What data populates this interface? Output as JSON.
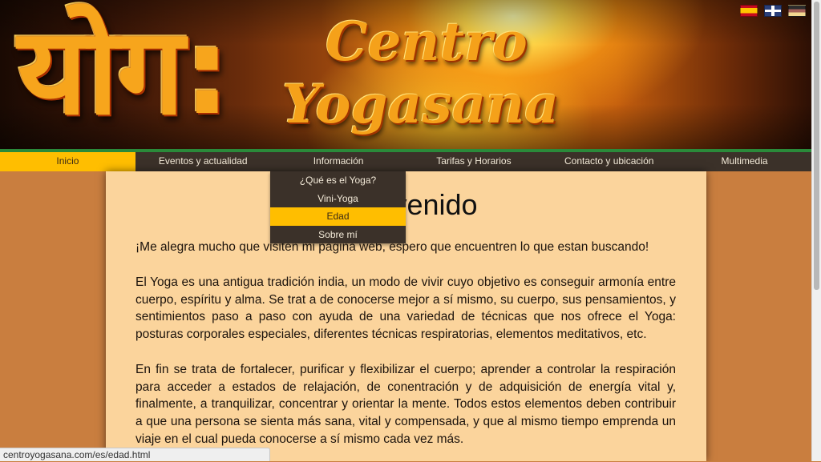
{
  "banner": {
    "logo_devanagari": "योग:",
    "logo_line1": "Centro",
    "logo_line2": "Yogasana",
    "flags": [
      {
        "name": "spanish-flag-icon",
        "lang": "es"
      },
      {
        "name": "english-flag-icon",
        "lang": "en"
      },
      {
        "name": "german-flag-icon",
        "lang": "de"
      }
    ]
  },
  "nav": {
    "items": [
      {
        "label": "Inicio",
        "active": true
      },
      {
        "label": "Eventos y actualidad",
        "active": false
      },
      {
        "label": "Información",
        "active": false
      },
      {
        "label": "Tarifas y Horarios",
        "active": false
      },
      {
        "label": "Contacto y ubicación",
        "active": false
      },
      {
        "label": "Multimedia",
        "active": false
      }
    ],
    "active_color": "#ffbe00",
    "bar_color": "#3b3129"
  },
  "dropdown": {
    "items": [
      {
        "label": "¿Qué es el Yoga?",
        "active": false
      },
      {
        "label": "Vini-Yoga",
        "active": false
      },
      {
        "label": "Edad",
        "active": true
      },
      {
        "label": "Sobre mí",
        "active": false
      }
    ]
  },
  "content": {
    "heading": "Bienvenido",
    "paragraphs": [
      "¡Me alegra mucho que visiten mi pagina web, espero que encuentren lo que estan buscando!",
      "El Yoga es una antigua tradición india, un modo de vivir cuyo objetivo es conseguir armonía entre cuerpo, espíritu y alma. Se trat a de conocerse mejor a sí mismo, su cuerpo, sus pensamientos, y sentimientos paso a paso con ayuda de una variedad de técnicas que nos ofrece el Yoga: posturas corporales especiales, diferentes técnicas respiratorias, elementos meditativos, etc.",
      "En fin se trata de fortalecer, purificar y flexibilizar el cuerpo; aprender a controlar la respiración para acceder a estados de relajación, de conentración y de adquisición de energía vital y, finalmente, a tranquilizar, concentrar y orientar la mente. Todos estos elementos deben contribuir a que una persona se sienta más sana, vital y compensada, y que al mismo tiempo emprenda un viaje en el cual pueda conocerse a sí mismo cada vez más."
    ]
  },
  "status": {
    "url": "centroyogasana.com/es/edad.html"
  }
}
